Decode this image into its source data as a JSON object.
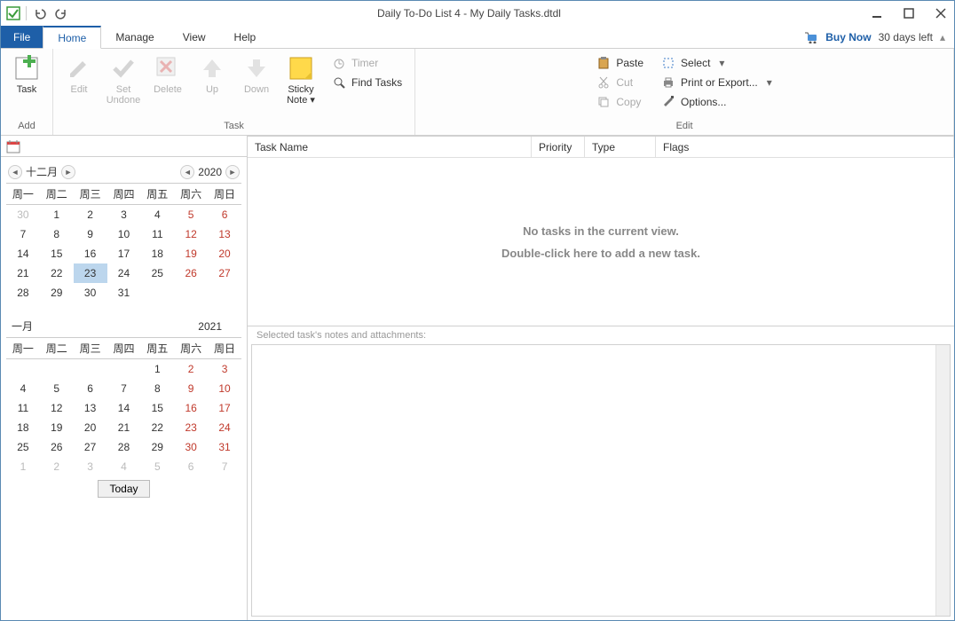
{
  "window": {
    "title": "Daily To-Do List 4 - My Daily Tasks.dtdl"
  },
  "trial": {
    "buy_now": "Buy Now",
    "days_left": "30 days left"
  },
  "menu": {
    "file": "File",
    "tabs": [
      "Home",
      "Manage",
      "View",
      "Help"
    ],
    "active": "Home"
  },
  "ribbon": {
    "add_group": "Add",
    "task_group": "Task",
    "edit_group": "Edit",
    "task_btn": "Task",
    "edit_btn": "Edit",
    "set_undone_btn": "Set\nUndone",
    "delete_btn": "Delete",
    "up_btn": "Up",
    "down_btn": "Down",
    "sticky_note_btn": "Sticky\nNote ▾",
    "timer": "Timer",
    "find_tasks": "Find Tasks",
    "paste": "Paste",
    "cut": "Cut",
    "copy": "Copy",
    "select": "Select",
    "print_export": "Print or Export...",
    "options": "Options..."
  },
  "task_list": {
    "columns": [
      "Task Name",
      "Priority",
      "Type",
      "Flags"
    ],
    "empty_line1": "No tasks in the current view.",
    "empty_line2": "Double-click here to add a new task."
  },
  "notes": {
    "label": "Selected task's notes and attachments:"
  },
  "calendar1": {
    "month_label": "十二月",
    "year_label": "2020",
    "weekdays": [
      "周一",
      "周二",
      "周三",
      "周四",
      "周五",
      "周六",
      "周日"
    ],
    "rows": [
      [
        {
          "d": "30",
          "o": true
        },
        {
          "d": "1"
        },
        {
          "d": "2"
        },
        {
          "d": "3"
        },
        {
          "d": "4"
        },
        {
          "d": "5",
          "w": true
        },
        {
          "d": "6",
          "w": true
        }
      ],
      [
        {
          "d": "7"
        },
        {
          "d": "8"
        },
        {
          "d": "9"
        },
        {
          "d": "10"
        },
        {
          "d": "11"
        },
        {
          "d": "12",
          "w": true
        },
        {
          "d": "13",
          "w": true
        }
      ],
      [
        {
          "d": "14"
        },
        {
          "d": "15"
        },
        {
          "d": "16"
        },
        {
          "d": "17"
        },
        {
          "d": "18"
        },
        {
          "d": "19",
          "w": true
        },
        {
          "d": "20",
          "w": true
        }
      ],
      [
        {
          "d": "21"
        },
        {
          "d": "22"
        },
        {
          "d": "23",
          "t": true
        },
        {
          "d": "24"
        },
        {
          "d": "25"
        },
        {
          "d": "26",
          "w": true
        },
        {
          "d": "27",
          "w": true
        }
      ],
      [
        {
          "d": "28"
        },
        {
          "d": "29"
        },
        {
          "d": "30"
        },
        {
          "d": "31"
        },
        {
          "d": ""
        },
        {
          "d": ""
        },
        {
          "d": ""
        }
      ]
    ]
  },
  "calendar2": {
    "month_label": "一月",
    "year_label": "2021",
    "weekdays": [
      "周一",
      "周二",
      "周三",
      "周四",
      "周五",
      "周六",
      "周日"
    ],
    "rows": [
      [
        {
          "d": ""
        },
        {
          "d": ""
        },
        {
          "d": ""
        },
        {
          "d": ""
        },
        {
          "d": "1"
        },
        {
          "d": "2",
          "w": true
        },
        {
          "d": "3",
          "w": true
        }
      ],
      [
        {
          "d": "4"
        },
        {
          "d": "5"
        },
        {
          "d": "6"
        },
        {
          "d": "7"
        },
        {
          "d": "8"
        },
        {
          "d": "9",
          "w": true
        },
        {
          "d": "10",
          "w": true
        }
      ],
      [
        {
          "d": "11"
        },
        {
          "d": "12"
        },
        {
          "d": "13"
        },
        {
          "d": "14"
        },
        {
          "d": "15"
        },
        {
          "d": "16",
          "w": true
        },
        {
          "d": "17",
          "w": true
        }
      ],
      [
        {
          "d": "18"
        },
        {
          "d": "19"
        },
        {
          "d": "20"
        },
        {
          "d": "21"
        },
        {
          "d": "22"
        },
        {
          "d": "23",
          "w": true
        },
        {
          "d": "24",
          "w": true
        }
      ],
      [
        {
          "d": "25"
        },
        {
          "d": "26"
        },
        {
          "d": "27"
        },
        {
          "d": "28"
        },
        {
          "d": "29"
        },
        {
          "d": "30",
          "w": true
        },
        {
          "d": "31",
          "w": true
        }
      ],
      [
        {
          "d": "1",
          "o": true
        },
        {
          "d": "2",
          "o": true
        },
        {
          "d": "3",
          "o": true
        },
        {
          "d": "4",
          "o": true
        },
        {
          "d": "5",
          "o": true
        },
        {
          "d": "6",
          "o": true
        },
        {
          "d": "7",
          "o": true
        }
      ]
    ]
  },
  "today_btn": "Today"
}
